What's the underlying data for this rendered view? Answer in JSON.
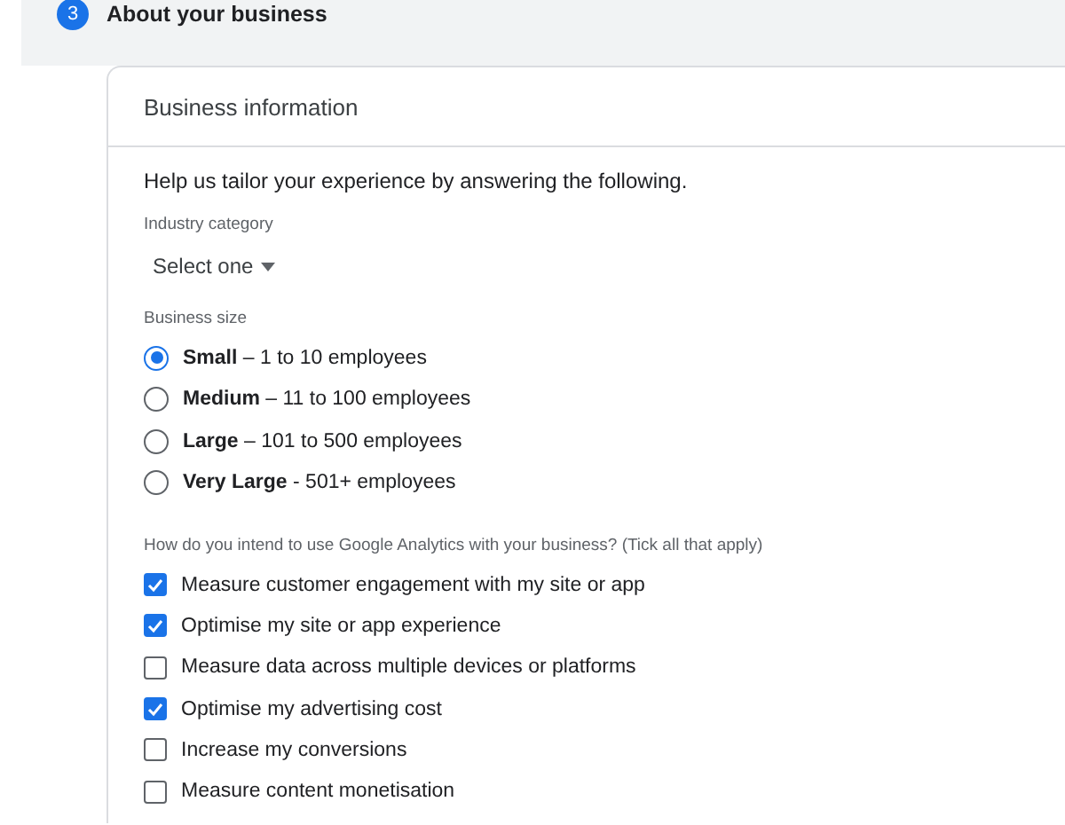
{
  "step": {
    "number": "3",
    "title": "About your business"
  },
  "card": {
    "title": "Business information",
    "intro": "Help us tailor your experience by answering the following.",
    "industry": {
      "label": "Industry category",
      "value": "Select one"
    },
    "size": {
      "label": "Business size",
      "options": [
        {
          "label": "**Small** – 1 to 10 employees",
          "selected": true
        },
        {
          "label": "**Medium** – 11 to 100 employees",
          "selected": false
        },
        {
          "label": "**Large** – 101 to 500 employees",
          "selected": false
        },
        {
          "label": "**Very Large** - 501+ employees",
          "selected": false
        }
      ]
    },
    "usage": {
      "label": "How do you intend to use Google Analytics with your business? (Tick all that apply)",
      "options": [
        {
          "label": "Measure customer engagement with my site or app",
          "checked": true
        },
        {
          "label": "Optimise my site or app experience",
          "checked": true
        },
        {
          "label": "Measure data across multiple devices or platforms",
          "checked": false
        },
        {
          "label": "Optimise my advertising cost",
          "checked": true
        },
        {
          "label": "Increase my conversions",
          "checked": false
        },
        {
          "label": "Measure content monetisation",
          "checked": false
        }
      ]
    }
  }
}
